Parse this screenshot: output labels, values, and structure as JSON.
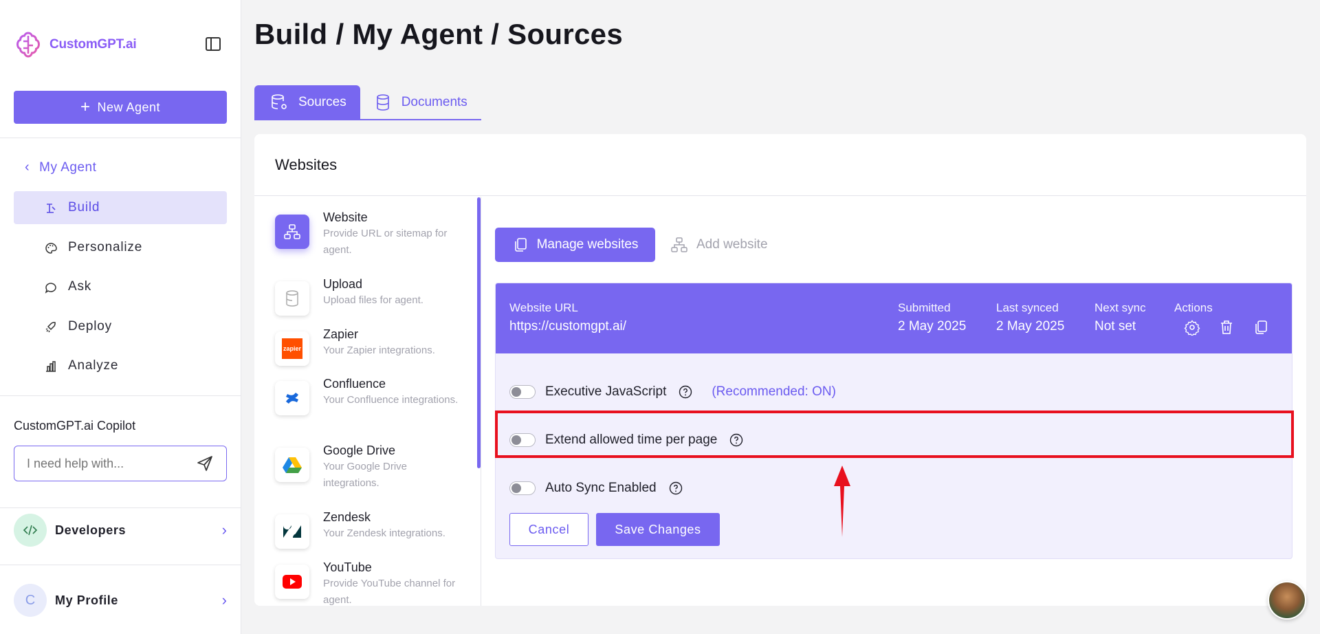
{
  "sidebar": {
    "logo_text": "CustomGPT.ai",
    "new_agent_label": "New Agent",
    "back_label": "My Agent",
    "nav": [
      {
        "label": "Build",
        "icon": "build-icon",
        "active": true
      },
      {
        "label": "Personalize",
        "icon": "palette-icon",
        "active": false
      },
      {
        "label": "Ask",
        "icon": "chat-icon",
        "active": false
      },
      {
        "label": "Deploy",
        "icon": "rocket-icon",
        "active": false
      },
      {
        "label": "Analyze",
        "icon": "bar-chart-icon",
        "active": false
      }
    ],
    "copilot_title": "CustomGPT.ai Copilot",
    "copilot_placeholder": "I need help with...",
    "developers_label": "Developers",
    "profile_label": "My Profile",
    "profile_initial": "C"
  },
  "header": {
    "title": "Build / My Agent / Sources"
  },
  "tabs": [
    {
      "label": "Sources",
      "active": true
    },
    {
      "label": "Documents",
      "active": false
    }
  ],
  "card": {
    "title": "Websites"
  },
  "sources": [
    {
      "name": "Website",
      "desc": "Provide URL or sitemap for agent."
    },
    {
      "name": "Upload",
      "desc": "Upload files for agent."
    },
    {
      "name": "Zapier",
      "desc": "Your Zapier integrations."
    },
    {
      "name": "Confluence",
      "desc": "Your Confluence integrations."
    },
    {
      "name": "Google Drive",
      "desc": "Your Google Drive integrations."
    },
    {
      "name": "Zendesk",
      "desc": "Your Zendesk integrations."
    },
    {
      "name": "YouTube",
      "desc": "Provide YouTube channel for agent."
    }
  ],
  "zapier_badge": "zapier",
  "actions": {
    "manage_label": "Manage websites",
    "add_label": "Add website"
  },
  "website_table": {
    "url_header": "Website URL",
    "url_value": "https://customgpt.ai/",
    "submitted_header": "Submitted",
    "submitted_value": "2 May 2025",
    "last_synced_header": "Last synced",
    "last_synced_value": "2 May 2025",
    "next_sync_header": "Next sync",
    "next_sync_value": "Not set",
    "actions_header": "Actions"
  },
  "options": {
    "js_label": "Executive JavaScript",
    "js_recommend": "(Recommended: ON)",
    "extend_label": "Extend allowed time per page",
    "autosync_label": "Auto Sync Enabled",
    "js_on": false,
    "extend_on": false,
    "autosync_on": false
  },
  "buttons": {
    "cancel_label": "Cancel",
    "save_label": "Save Changes"
  },
  "colors": {
    "accent": "#7867f0",
    "highlight": "#e8101e"
  }
}
